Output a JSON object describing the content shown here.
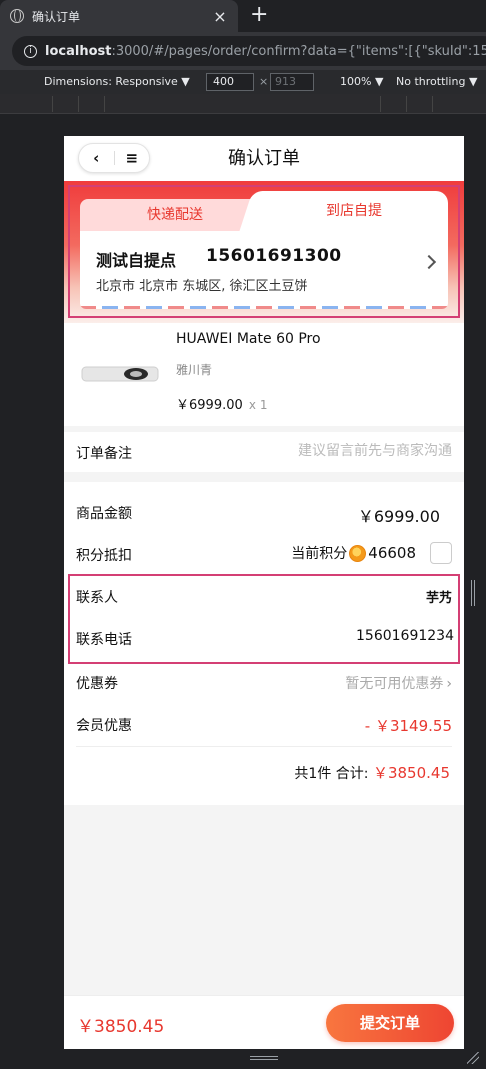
{
  "browser": {
    "tab_title": "确认订单",
    "tab_close": "×",
    "new_tab": "+",
    "url_host": "localhost",
    "url_rest": ":3000/#/pages/order/confirm?data={\"items\":[{\"skuId\":15,\""
  },
  "devtools": {
    "dimensions_label": "Dimensions: Responsive ▼",
    "width_value": "400",
    "times": "×",
    "height_placeholder": "913",
    "zoom_label": "100% ▼",
    "throttling_label": "No throttling ▼"
  },
  "nav": {
    "back_icon": "‹",
    "menu_icon": "≡",
    "title": "确认订单"
  },
  "delivery": {
    "tab_express": "快递配送",
    "tab_pickup": "到店自提",
    "pickup_name": "测试自提点",
    "pickup_phone": "15601691300",
    "pickup_address": "北京市 北京市 东城区, 徐汇区土豆饼"
  },
  "product": {
    "name": "HUAWEI Mate 60 Pro",
    "variant": "雅川青",
    "price": "￥6999.00",
    "qty": "x 1"
  },
  "remark": {
    "label": "订单备注",
    "placeholder": "建议留言前先与商家沟通"
  },
  "summary": {
    "goods_label": "商品金额",
    "goods_value": "￥6999.00",
    "points_label_row": "积分抵扣",
    "points_label": "当前积分",
    "points_value": "46608",
    "contact_label": "联系人",
    "contact_value": "芋艿",
    "phone_label": "联系电话",
    "phone_value": "15601691234",
    "coupon_label": "优惠券",
    "coupon_value": "暂无可用优惠券",
    "coupon_chevron": "›",
    "member_label": "会员优惠",
    "member_value": "- ￥3149.55",
    "total_count": "共1件",
    "total_label": "合计:",
    "total_amount": "￥3850.45"
  },
  "bottom": {
    "price": "￥3850.45",
    "submit": "提交订单"
  },
  "colors": {
    "accent": "#e8382f",
    "highlight_box": "#d43f74"
  }
}
